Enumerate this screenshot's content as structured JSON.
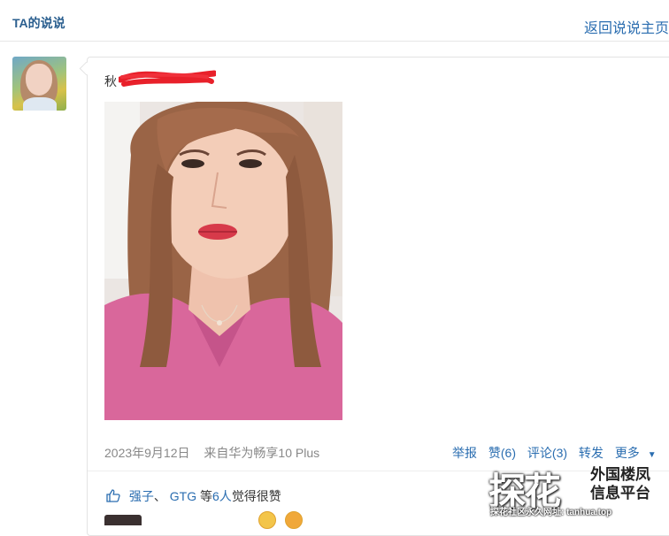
{
  "header": {
    "title": "TA的说说",
    "back_link": "返回说说主页"
  },
  "post": {
    "text_prefix": "秋",
    "text_suffix": "",
    "date": "2023年9月12日",
    "source": "来自华为畅享10 Plus",
    "actions": {
      "report": "举报",
      "like": "赞(6)",
      "comment": "评论(3)",
      "forward": "转发",
      "more": "更多"
    },
    "likes": {
      "names": [
        "强子",
        "GTG"
      ],
      "separator": "、",
      "middle": "等",
      "count": "6人",
      "suffix": "觉得很赞"
    }
  },
  "watermark": {
    "big": "探花",
    "line1": "外国楼凤",
    "line2": "信息平台",
    "bottom": "探花社区永久网址: tanhua.top"
  },
  "colors": {
    "link": "#2a6db0",
    "header_title": "#2b5f8f",
    "redact": "#e8202a"
  }
}
